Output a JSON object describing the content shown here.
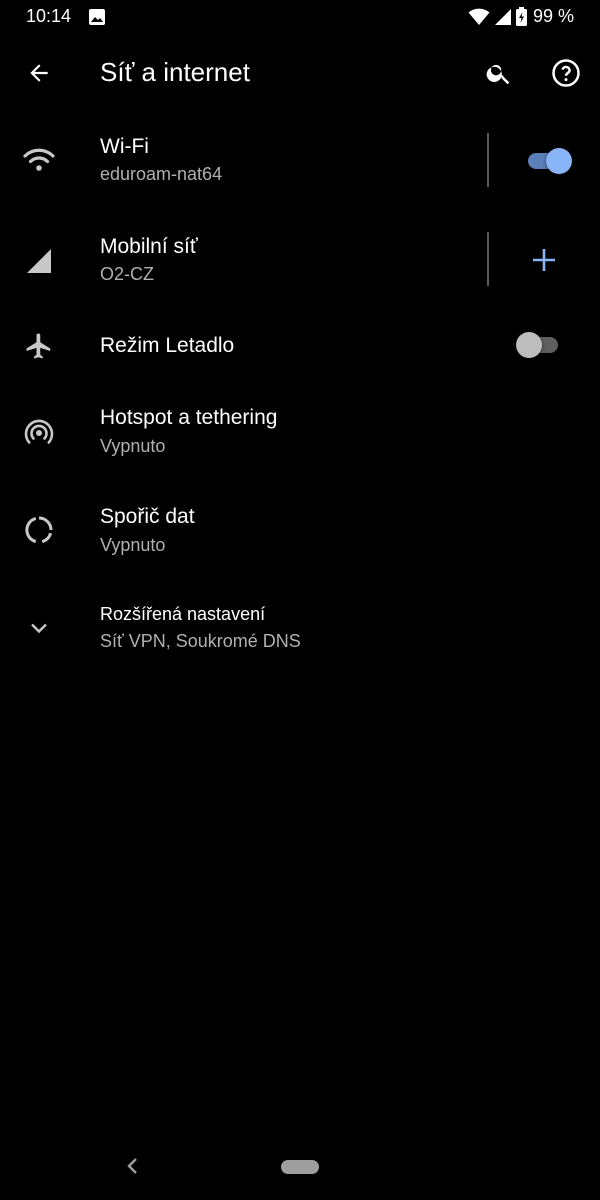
{
  "status_bar": {
    "time": "10:14",
    "battery": "99 %"
  },
  "toolbar": {
    "title": "Síť a internet"
  },
  "items": [
    {
      "title": "Wi-Fi",
      "subtitle": "eduroam-nat64",
      "icon": "wifi-icon",
      "control": "switch",
      "checked": true
    },
    {
      "title": "Mobilní síť",
      "subtitle": "O2-CZ",
      "icon": "cellular-signal-icon",
      "control": "plus"
    },
    {
      "title": "Režim Letadlo",
      "icon": "airplane-icon",
      "control": "switch",
      "checked": false
    },
    {
      "title": "Hotspot a tethering",
      "subtitle": "Vypnuto",
      "icon": "hotspot-icon"
    },
    {
      "title": "Spořič dat",
      "subtitle": "Vypnuto",
      "icon": "data-saver-icon"
    },
    {
      "title": "Rozšířená nastavení",
      "subtitle": "Síť VPN, Soukromé DNS",
      "icon": "chevron-down-icon"
    }
  ],
  "colors": {
    "background": "#000000",
    "accent": "#8ab4f8",
    "accent_track": "#5b7fb8",
    "switch_off_thumb": "#bdbdbd",
    "switch_off_track": "#5f5f5f",
    "icon_gray": "#c8c8c8",
    "nav_pill": "#9e9e9e"
  }
}
